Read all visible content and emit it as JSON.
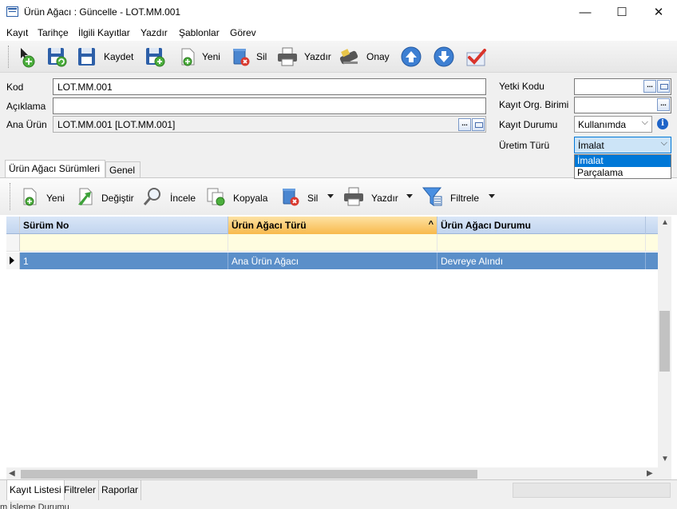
{
  "window": {
    "title": "Ürün Ağacı : Güncelle - LOT.MM.001",
    "minimize": "—",
    "maximize": "☐",
    "close": "✕"
  },
  "menu": [
    "Kayıt",
    "Tarihçe",
    "İlgili Kayıtlar",
    "Yazdır",
    "Şablonlar",
    "Görev"
  ],
  "toolbar": {
    "save_label": "Kaydet",
    "new_label": "Yeni",
    "delete_label": "Sil",
    "print_label": "Yazdır",
    "approve_label": "Onay"
  },
  "form": {
    "code_label": "Kod",
    "code_value": "LOT.MM.001",
    "description_label": "Açıklama",
    "description_value": "",
    "main_product_label": "Ana Ürün",
    "main_product_value": "LOT.MM.001 [LOT.MM.001]",
    "auth_code_label": "Yetki Kodu",
    "auth_code_value": "",
    "org_unit_label": "Kayıt Org. Birimi",
    "org_unit_value": "",
    "record_status_label": "Kayıt Durumu",
    "record_status_value": "Kullanımda",
    "production_type_label": "Üretim Türü",
    "production_type_value": "İmalat",
    "production_type_options": [
      "İmalat",
      "Parçalama"
    ],
    "dots": "..."
  },
  "tabs": [
    "Ürün Ağacı Sürümleri",
    "Genel"
  ],
  "grid_toolbar": {
    "new": "Yeni",
    "change": "Değiştir",
    "inspect": "İncele",
    "copy": "Kopyala",
    "delete": "Sil",
    "print": "Yazdır",
    "filter": "Filtrele"
  },
  "grid": {
    "columns": [
      "Sürüm No",
      "Ürün Ağacı Türü",
      "Ürün Ağacı Durumu"
    ],
    "rows": [
      [
        "1",
        "Ana Ürün Ağacı",
        "Devreye Alındı"
      ]
    ]
  },
  "bottom_tabs": [
    "Kayıt Listesi",
    "Filtreler",
    "Raporlar"
  ],
  "status_text": "m İşleme Durumu"
}
